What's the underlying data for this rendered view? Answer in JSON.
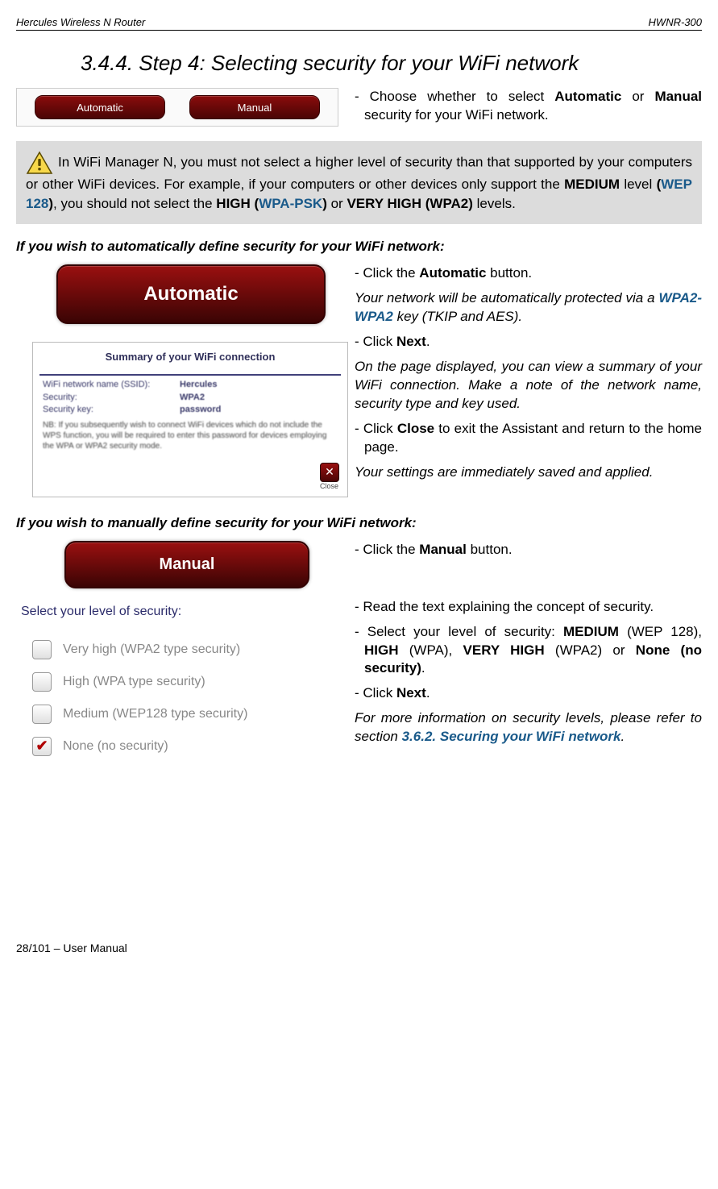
{
  "header": {
    "left": "Hercules Wireless N Router",
    "right": "HWNR-300"
  },
  "section_title": "3.4.4. Step 4: Selecting security for your WiFi network",
  "btnbar": {
    "auto": "Automatic",
    "manual": "Manual"
  },
  "intro_choose": "- Choose whether to select <b>Automatic</b> or <b>Manual</b> security for your WiFi network.",
  "tip": {
    "lead_spacer": " ",
    "part1": "In WiFi Manager N, you must not select a higher level of security than that supported by your computers or other WiFi devices.  For example, if your computers or other devices only support the ",
    "medium": "MEDIUM",
    "part2": " level ",
    "open_paren": "(",
    "wep": "WEP 128",
    "close_paren": ")",
    "part3": ", you should not select the ",
    "high": "HIGH (",
    "wpapsk": "WPA-PSK",
    "high_close": ")",
    "part4": " or ",
    "vhigh": "VERY HIGH (WPA2)",
    "part5": " levels."
  },
  "sub_auto": "If you wish to automatically define security for your WiFi network:",
  "auto_big": "Automatic",
  "summary": {
    "title": "Summary of your WiFi connection",
    "ssid_k": "WiFi network name (SSID):",
    "ssid_v": "Hercules",
    "sec_k": "Security:",
    "sec_v": "WPA2",
    "key_k": "Security key:",
    "key_v": "password",
    "note": "NB: If you subsequently wish to connect WiFi devices which do not include the WPS function, you will be required to enter this password for devices employing the WPA or WPA2 security mode.",
    "close": "Close"
  },
  "auto_steps": {
    "s1": "- Click the <b>Automatic</b> button.",
    "s2a": "Your network will be automatically protected via a ",
    "s2link": "WPA2-WPA2",
    "s2b": " key (TKIP and AES).",
    "s3": "- Click <b>Next</b>.",
    "s4": "On the page displayed, you can view a summary of your WiFi connection.  Make a note of the network name, security type and key used.",
    "s5": "- Click <b>Close</b> to exit the Assistant and return to the home page.",
    "s6": "Your settings are immediately saved and applied."
  },
  "sub_manual": "If you wish to manually define security for your WiFi network:",
  "manual_big": "Manual",
  "sec_panel": {
    "label": "Select your level of security:",
    "opt_vh": "Very high (WPA2 type security)",
    "opt_h": "High (WPA type security)",
    "opt_m": "Medium (WEP128 type security)",
    "opt_n": "None (no security)"
  },
  "manual_steps": {
    "m1": "- Click the <b>Manual</b> button.",
    "m2": "- Read the text explaining the concept of security.",
    "m3": "- Select your level of security: <b>MEDIUM</b> (WEP 128), <b>HIGH</b> (WPA), <b>VERY HIGH</b> (WPA2) or <b>None (no security)</b>.",
    "m4": "- Click <b>Next</b>.",
    "m5a": "For more information on security levels, please refer to section ",
    "m5link": "3.6.2. Securing your WiFi network",
    "m5b": "."
  },
  "footer": "28/101 – User Manual"
}
